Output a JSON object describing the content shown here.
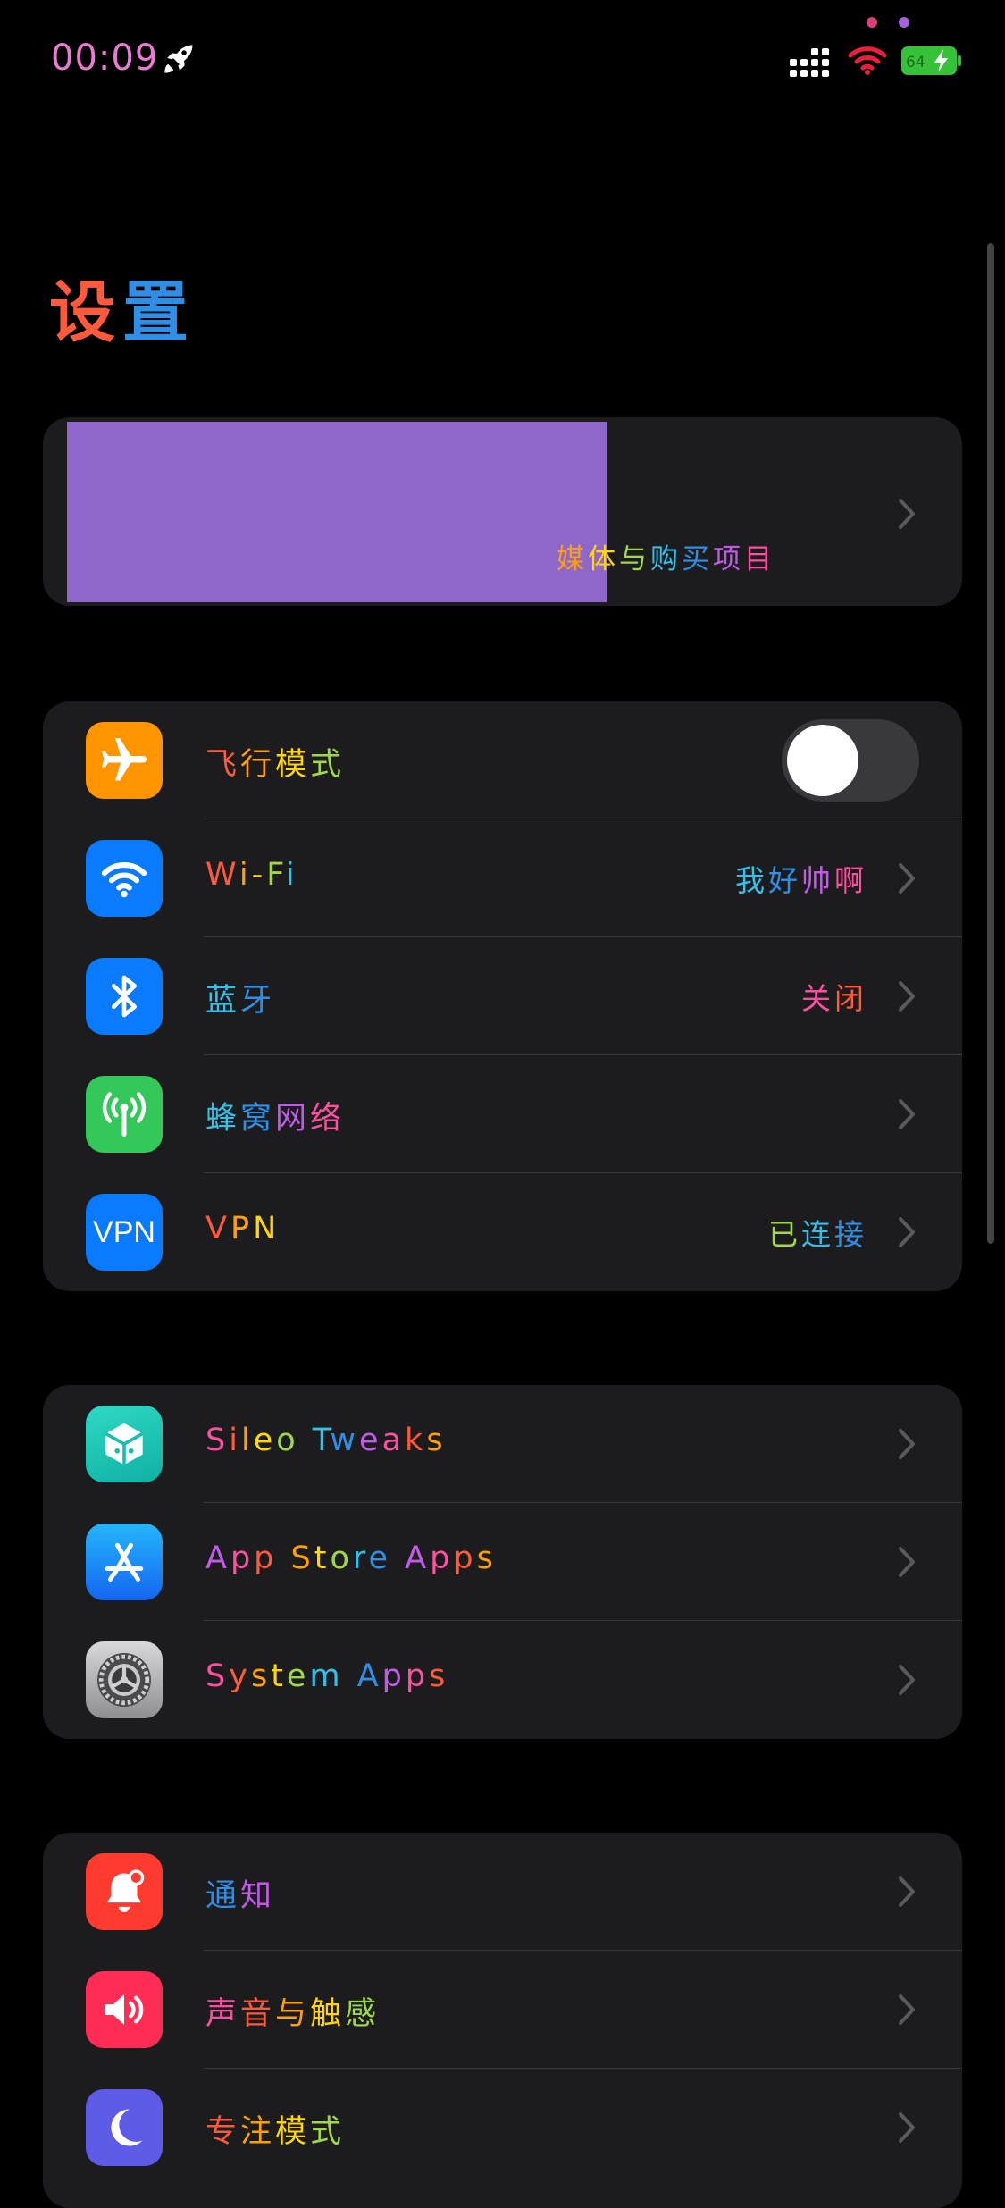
{
  "status_bar": {
    "time": "00:09",
    "battery_level": "64",
    "colors": {
      "time": "#e87ad0",
      "dot_left": "#d8407a",
      "dot_right": "#a064d8",
      "wifi": "#e8203a",
      "battery": "#36c238"
    }
  },
  "page": {
    "title_part1": "设",
    "title_part2": "置"
  },
  "profile": {
    "subtitle": "媒体与购买项目",
    "redaction_color": "#8e67c9"
  },
  "connectivity": [
    {
      "label": "飞行模式",
      "icon": "airplane-icon",
      "icon_color": "#ff9500",
      "control": "toggle",
      "toggle_on": false
    },
    {
      "label": "Wi-Fi",
      "value": "我好帅啊",
      "icon": "wifi-icon",
      "icon_color": "#0a7aff"
    },
    {
      "label": "蓝牙",
      "value": "关闭",
      "icon": "bluetooth-icon",
      "icon_color": "#0a7aff"
    },
    {
      "label": "蜂窝网络",
      "value": "",
      "icon": "cellular-antenna-icon",
      "icon_color": "#34c759"
    },
    {
      "label": "VPN",
      "value": "已连接",
      "icon": "vpn-icon",
      "icon_color": "#0a7aff",
      "icon_text": "VPN"
    }
  ],
  "apps": [
    {
      "label": "Sileo Tweaks",
      "icon": "sileo-cube-icon",
      "icon_color": "#1ec8b4"
    },
    {
      "label": "App Store Apps",
      "icon": "app-store-icon",
      "icon_color": "#1a8cf5"
    },
    {
      "label": "System Apps",
      "icon": "settings-gear-icon",
      "icon_color": "#8e8e93"
    }
  ],
  "system": [
    {
      "label": "通知",
      "icon": "bell-icon",
      "icon_color": "#ff3b30"
    },
    {
      "label": "声音与触感",
      "icon": "speaker-icon",
      "icon_color": "#ff2d55"
    },
    {
      "label": "专注模式",
      "icon": "moon-icon",
      "icon_color": "#5e5ce6"
    }
  ],
  "text_palette": [
    "#ff5a3c",
    "#ff9f0a",
    "#ffd60a",
    "#a0d84a",
    "#34c0e8",
    "#2f8fe6",
    "#c25ae8",
    "#ff4fa0"
  ]
}
